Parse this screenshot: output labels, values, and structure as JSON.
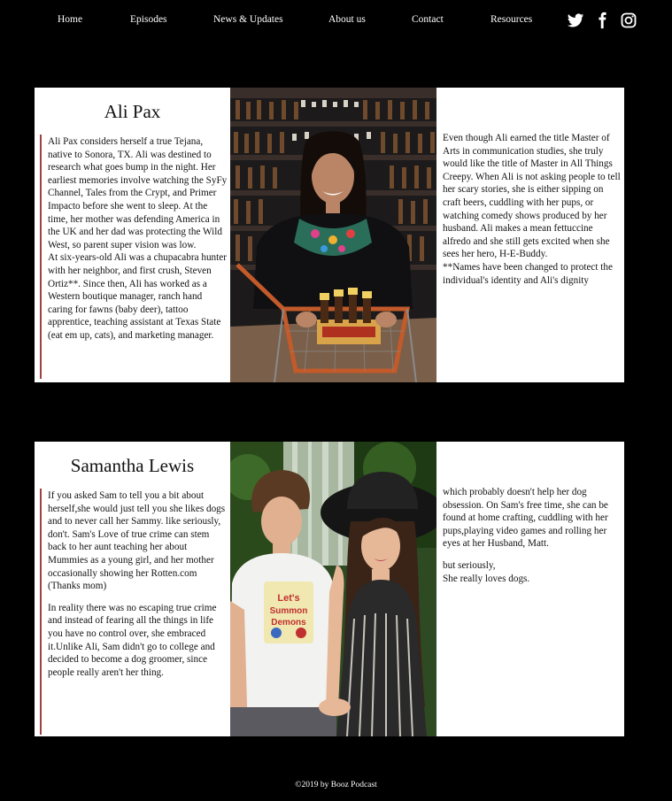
{
  "nav": {
    "items": [
      {
        "label": "Home",
        "name": "nav-home"
      },
      {
        "label": "Episodes",
        "name": "nav-episodes"
      },
      {
        "label": "News & Updates",
        "name": "nav-news-updates"
      },
      {
        "label": "About us",
        "name": "nav-about-us"
      },
      {
        "label": "Contact",
        "name": "nav-contact"
      },
      {
        "label": "Resources",
        "name": "nav-resources"
      }
    ],
    "social": [
      "twitter-icon",
      "facebook-icon",
      "instagram-icon"
    ]
  },
  "hosts": [
    {
      "name": "Ali Pax",
      "bio": [
        "Ali Pax considers herself a true Tejana, native to Sonora, TX. Ali was destined to research what goes bump in the night. Her earliest memories involve watching the SyFy Channel, Tales from the Crypt, and Primer Impacto before she went to sleep. At the time, her mother was defending America in the UK and her dad was protecting the Wild West, so parent super vision was low.",
        "At six-years-old Ali was a chupacabra hunter with her neighbor, and first crush, Steven Ortiz**. Since then, Ali has worked as a Western boutique manager, ranch hand caring for fawns (baby deer), tattoo apprentice, teaching assistant at Texas State (eat em up, cats), and marketing manager."
      ],
      "continued": [
        "Even though Ali earned the title Master of Arts in communication studies, she truly would like the title of Master in All Things Creepy. When Ali is not asking people to tell her scary stories, she is either sipping on craft beers, cuddling with her pups, or watching comedy shows produced by her husband. Ali makes a mean fettuccine alfredo and she still gets excited when she sees her hero, H-E-Buddy.",
        "**Names have been changed to protect the individual's identity and Ali's dignity"
      ]
    },
    {
      "name": "Samantha Lewis",
      "bio": [
        "If you asked Sam to tell you a bit about herself,she would just tell you she likes dogs and to never call her Sammy. like seriously, don't. Sam's Love of true crime can stem back to her aunt teaching her about Mummies as a young girl, and her mother occasionally showing her Rotten.com (Thanks mom)",
        "In reality there was no escaping true crime and instead of fearing all the things in life you have no control over, she embraced it.Unlike Ali, Sam didn't go to college and decided to become a dog groomer, since people really aren't her thing."
      ],
      "continued": [
        "which probably doesn't help her dog obsession. On Sam's free time, she can be found at home crafting, cuddling with her pups,playing video games and rolling her eyes at her Husband, Matt.",
        "but seriously,",
        "She really loves dogs."
      ]
    }
  ],
  "footer": "©2019 by Booz Podcast"
}
